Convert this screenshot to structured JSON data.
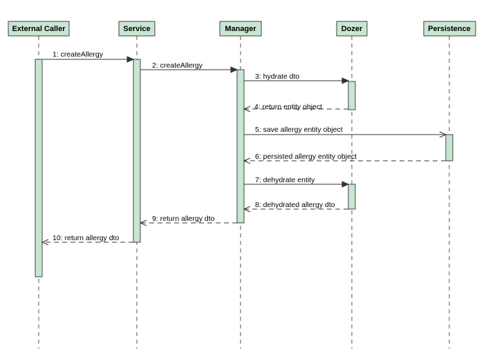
{
  "participants": [
    {
      "id": "external_caller",
      "label": "External Caller"
    },
    {
      "id": "service",
      "label": "Service"
    },
    {
      "id": "manager",
      "label": "Manager"
    },
    {
      "id": "dozer",
      "label": "Dozer"
    },
    {
      "id": "persistence",
      "label": "Persistence"
    }
  ],
  "messages": [
    {
      "label": "1: createAllergy",
      "from": "external_caller",
      "to": "service",
      "kind": "call"
    },
    {
      "label": "2: createAllergy",
      "from": "service",
      "to": "manager",
      "kind": "call"
    },
    {
      "label": "3: hydrate dto",
      "from": "manager",
      "to": "dozer",
      "kind": "call"
    },
    {
      "label": "4: return entity object",
      "from": "dozer",
      "to": "manager",
      "kind": "return"
    },
    {
      "label": "5: save allergy entity object",
      "from": "manager",
      "to": "persistence",
      "kind": "async"
    },
    {
      "label": "6: persisted allergy entity object",
      "from": "persistence",
      "to": "manager",
      "kind": "return"
    },
    {
      "label": "7: dehydrate entity",
      "from": "manager",
      "to": "dozer",
      "kind": "call"
    },
    {
      "label": "8: dehydrated allergy dto",
      "from": "dozer",
      "to": "manager",
      "kind": "return"
    },
    {
      "label": "9: return allergy dto",
      "from": "manager",
      "to": "service",
      "kind": "return"
    },
    {
      "label": "10: return allergy dto",
      "from": "service",
      "to": "external_caller",
      "kind": "return"
    }
  ],
  "colors": {
    "box_fill": "#c8e6d2",
    "line": "#333333"
  }
}
